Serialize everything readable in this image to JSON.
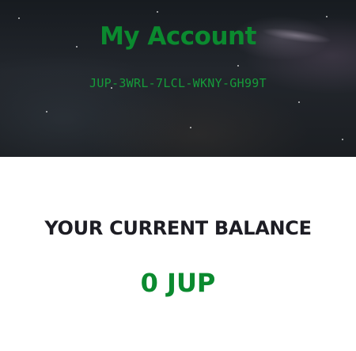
{
  "header": {
    "title": "My Account",
    "account_id": "JUP-3WRL-7LCL-WKNY-GH99T"
  },
  "balance": {
    "label": "YOUR CURRENT BALANCE",
    "value": "0 JUP"
  },
  "colors": {
    "accent": "#0b8a2f",
    "heading": "#1d1d24",
    "hero_background": "#1b1e22"
  }
}
